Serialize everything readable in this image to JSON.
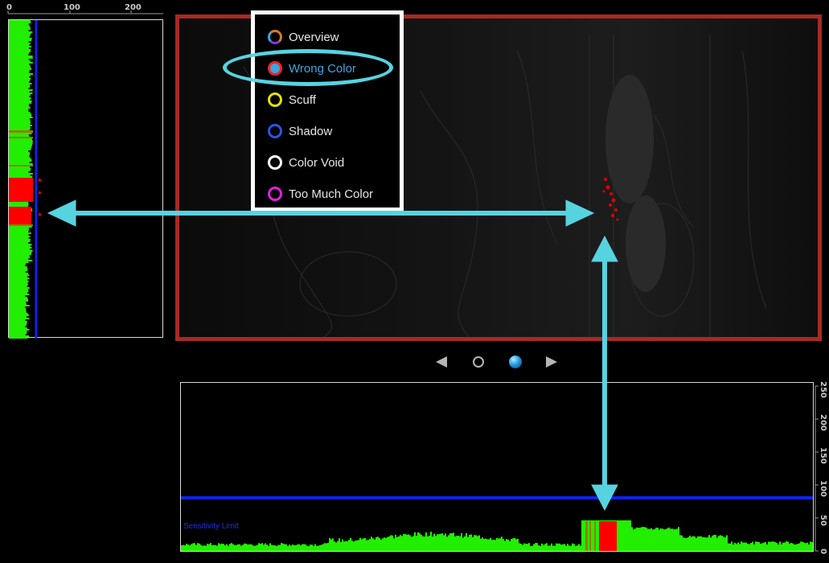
{
  "left_axis": {
    "ticks": [
      "0",
      "100",
      "200"
    ]
  },
  "mode_menu": {
    "items": [
      {
        "label": "Overview",
        "icon": "overview-ring-icon"
      },
      {
        "label": "Wrong Color",
        "icon": "wrong-color-ring-icon"
      },
      {
        "label": "Scuff",
        "icon": "scuff-ring-icon"
      },
      {
        "label": "Shadow",
        "icon": "shadow-ring-icon"
      },
      {
        "label": "Color Void",
        "icon": "color-void-ring-icon"
      },
      {
        "label": "Too Much Color",
        "icon": "too-much-color-ring-icon"
      }
    ],
    "selected": "Wrong Color"
  },
  "pager": {
    "page_count": 2,
    "current_page": 2
  },
  "bottom_profile": {
    "sensitivity_label": "Sensitivity Limit"
  },
  "right_axis": {
    "ticks": [
      "250",
      "200",
      "150",
      "100",
      "50",
      "0"
    ]
  },
  "colors": {
    "frame": "#a62a24",
    "profile": "#22ee00",
    "defect": "#ff0000",
    "limit": "#1122ee",
    "highlight": "#57d3e0",
    "selected_text": "#3aa7e2"
  }
}
